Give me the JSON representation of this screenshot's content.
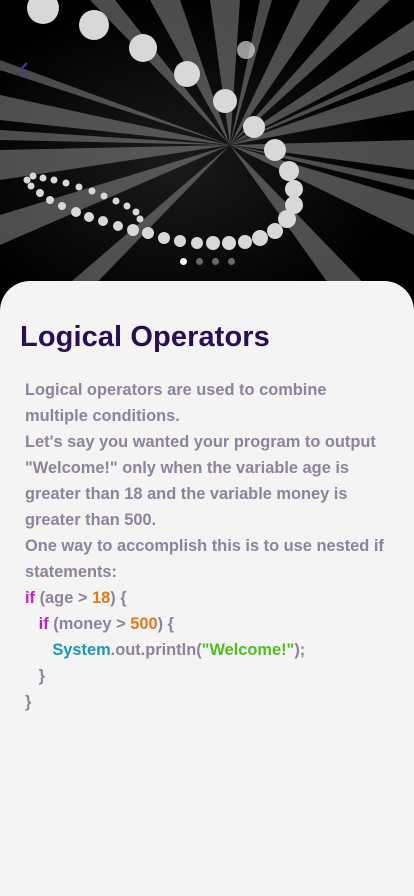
{
  "header": {
    "back_icon": "chevron-left-icon"
  },
  "carousel": {
    "slide_count": 4,
    "active_index": 0
  },
  "lesson": {
    "title": "Logical Operators",
    "paragraphs": [
      "Logical operators are used to combine multiple conditions.",
      "Let's say you wanted your program to output \"Welcome!\" only when the variable age is greater than 18 and the variable money is greater than 500.",
      "One way to accomplish this is to use nested if statements:"
    ]
  },
  "code": {
    "line1": {
      "kw": "if",
      "a": " (age > ",
      "num": "18",
      "b": ") {"
    },
    "line2": {
      "indent": "   ",
      "kw": "if",
      "a": " (money > ",
      "num": "500",
      "b": ") {"
    },
    "line3": {
      "indent": "      ",
      "cls": "System",
      "a": ".out.println(",
      "str": "\"Welcome!\"",
      "b": ");"
    },
    "line4": {
      "indent": "   ",
      "a": "}"
    },
    "line5": {
      "a": "}"
    }
  },
  "colors": {
    "title": "#2a0f55",
    "body_text": "#8e829c",
    "keyword": "#cc1bcc",
    "number": "#e07b1d",
    "class_name": "#1e96b8",
    "string": "#4fbf1c",
    "sheet_bg": "#f4f4f4"
  }
}
